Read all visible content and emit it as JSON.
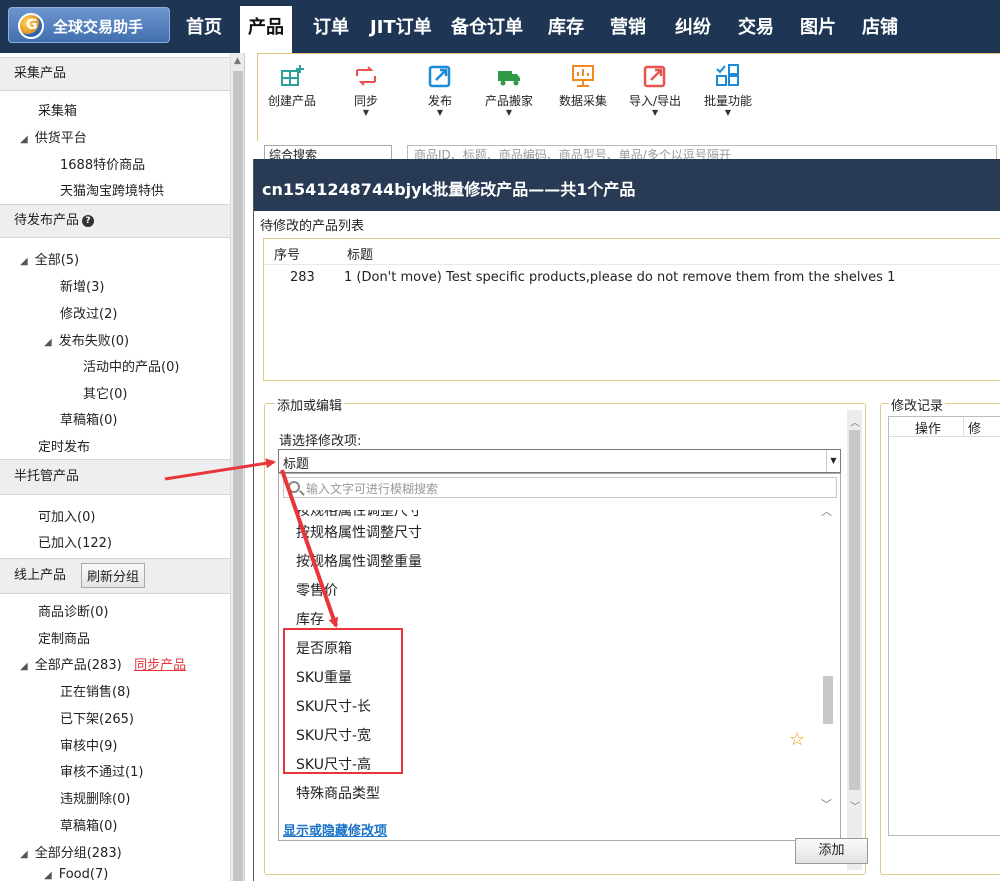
{
  "app": {
    "title": "全球交易助手",
    "logo_letter": "G"
  },
  "topnav": [
    "首页",
    "产品",
    "订单",
    "JIT订单",
    "备仓订单",
    "库存",
    "营销",
    "纠纷",
    "交易",
    "图片",
    "店铺"
  ],
  "sidebar": {
    "collect_section": "采集产品",
    "collect_box": "采集箱",
    "supply_platform": "供货平台",
    "supply_1688": "1688特价商品",
    "supply_tmall": "天猫淘宝跨境特供",
    "pending_section": "待发布产品",
    "all": "全部(5)",
    "added": "新增(3)",
    "modified": "修改过(2)",
    "publish_failed": "发布失败(0)",
    "active_products": "活动中的产品(0)",
    "other": "其它(0)",
    "drafts": "草稿箱(0)",
    "scheduled": "定时发布",
    "semi_section": "半托管产品",
    "can_join": "可加入(0)",
    "joined": "已加入(122)",
    "online_section": "线上产品",
    "refresh_group": "刷新分组",
    "diagnosis": "商品诊断(0)",
    "custom": "定制商品",
    "all_products": "全部产品(283)",
    "sync_products": "同步产品",
    "on_sale": "正在销售(8)",
    "off_shelf": "已下架(265)",
    "reviewing": "审核中(9)",
    "review_failed": "审核不通过(1)",
    "violation_deleted": "违规删除(0)",
    "drafts2": "草稿箱(0)",
    "all_groups": "全部分组(283)",
    "food": "Food(7)"
  },
  "toolbar": [
    "创建产品",
    "同步",
    "发布",
    "产品搬家",
    "数据采集",
    "导入/导出",
    "批量功能"
  ],
  "search": {
    "type": "综合搜索",
    "placeholder": "商品ID、标题、商品编码、商品型号、单品/多个以逗号隔开"
  },
  "dialog": {
    "title": "cn1541248744bjyk批量修改产品——共1个产品",
    "subtitle": "待修改的产品列表",
    "col_index": "序号",
    "col_title": "标题",
    "row_index": "283",
    "row_title": "1  (Don't move)  Test specific products,please do not remove them from the shelves 1",
    "addedit_legend": "添加或编辑",
    "choose_label": "请选择修改项:",
    "combo_value": "标题",
    "filter_placeholder": "输入文字可进行模糊搜索",
    "options": [
      "按规格属性调整尺寸",
      "按规格属性调整重量",
      "零售价",
      "库存",
      "是否原箱",
      "SKU重量",
      "SKU尺寸-长",
      "SKU尺寸-宽",
      "SKU尺寸-高",
      "特殊商品类型"
    ],
    "show_hide": "显示或隐藏修改项",
    "add_button": "添加",
    "record_legend": "修改记录",
    "record_col_action": "操作",
    "record_col_trunc": "修"
  },
  "colors": {
    "nav_bg": "#1e3654",
    "dialog_title_bg": "#293a54",
    "annotation_red": "#e8353a",
    "link_blue": "#1b73c8"
  }
}
